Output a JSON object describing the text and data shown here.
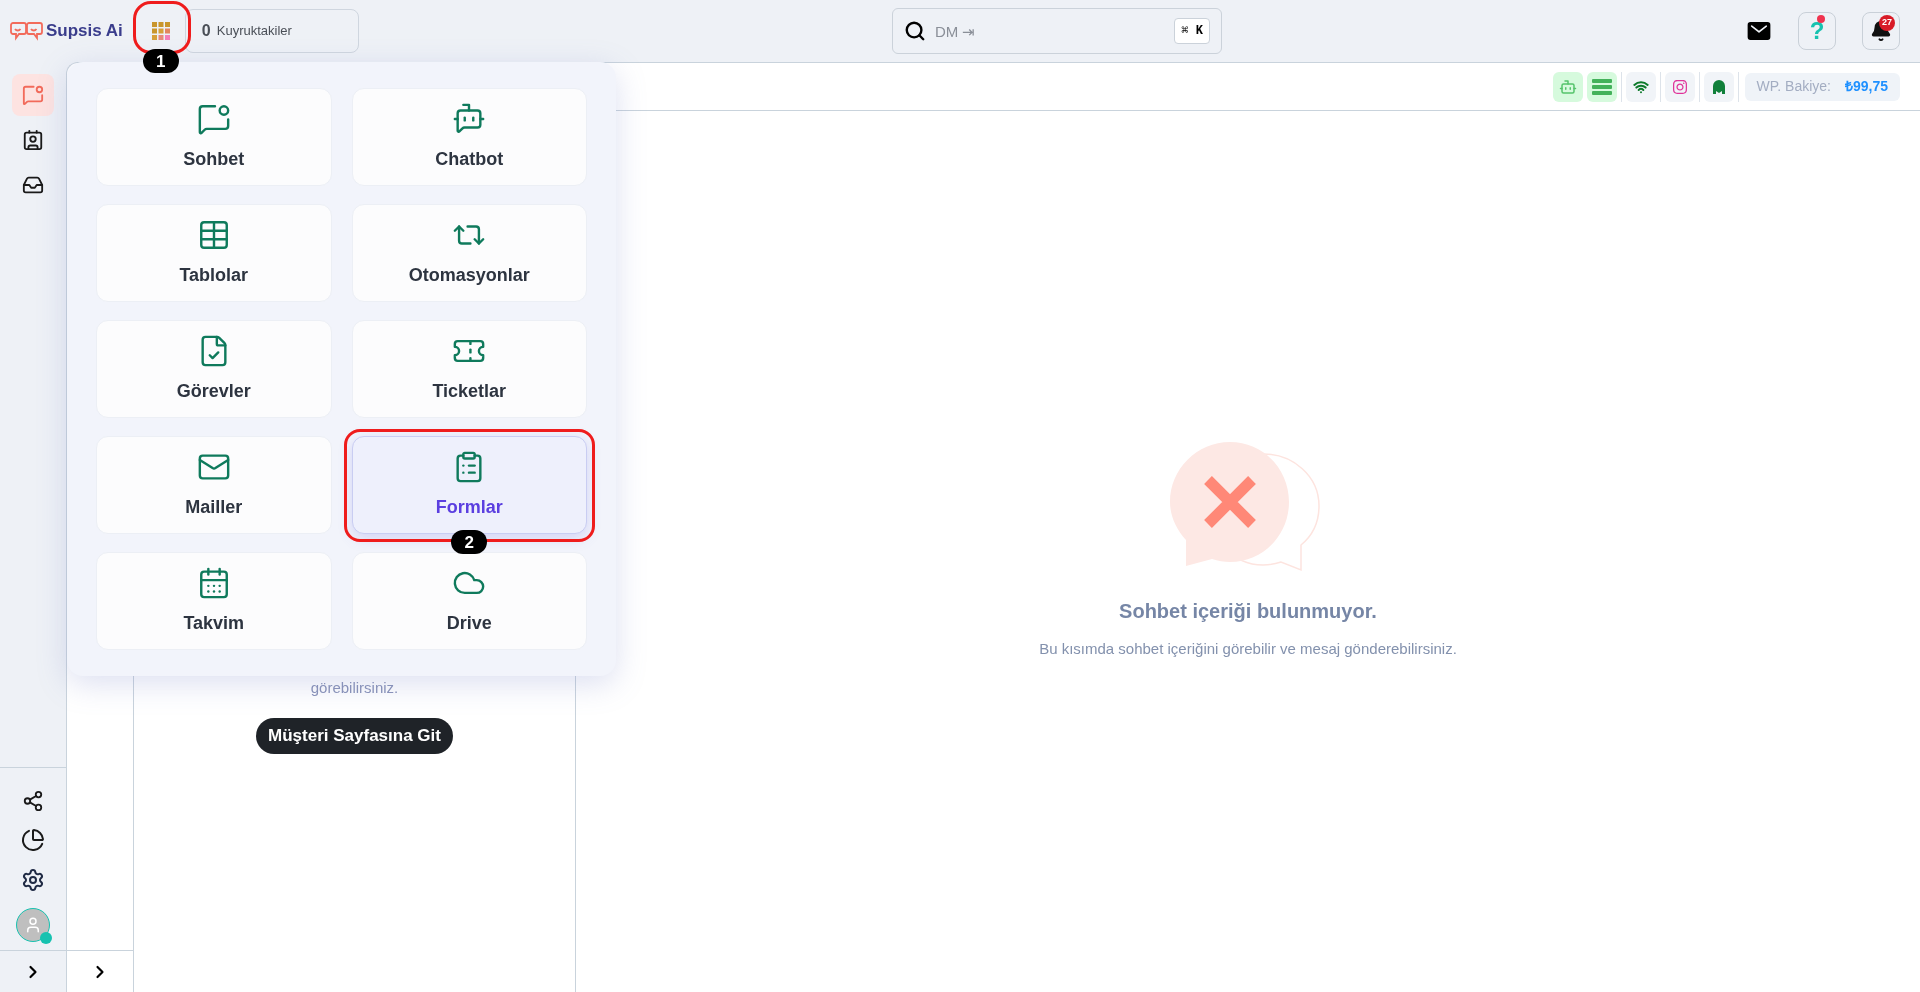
{
  "header": {
    "logo": {
      "text": "Supsis Ai"
    },
    "apps_button": {
      "annotation": "1"
    },
    "queue": {
      "count": "0",
      "label": "Kuyruktakiler"
    },
    "search": {
      "placeholder": "DM ⇥",
      "shortcut": "⌘ **K**"
    },
    "help_button": {
      "label": "?"
    },
    "notifications": {
      "badge": "27"
    }
  },
  "sidebar": {
    "items": [
      {
        "selected": true
      },
      {
        "selected": false
      },
      {
        "selected": false
      }
    ]
  },
  "customer_panel": {
    "text": "görebilirsiniz.",
    "button": "Müşteri Sayfasına Git"
  },
  "channels": {
    "items": [
      {
        "on": true
      },
      {
        "on": true
      },
      {
        "on": false
      },
      {
        "on": false
      },
      {
        "on": false
      }
    ],
    "balance_label": "WP. Bakiye:",
    "balance": "₺99,75"
  },
  "empty_state": {
    "title": "Sohbet içeriği bulunmuyor.",
    "subtitle": "Bu kısımda sohbet içeriğini görebilir ve mesaj gönderebilirsiniz."
  },
  "apps_menu": {
    "items": [
      {
        "label": "Sohbet",
        "selected": false
      },
      {
        "label": "Chatbot",
        "selected": false
      },
      {
        "label": "Tablolar",
        "selected": false
      },
      {
        "label": "Otomasyonlar",
        "selected": false
      },
      {
        "label": "Görevler",
        "selected": false
      },
      {
        "label": "Ticketlar",
        "selected": false
      },
      {
        "label": "Mailler",
        "selected": false
      },
      {
        "label": "Formlar",
        "selected": true,
        "annotation": "2"
      },
      {
        "label": "Takvim",
        "selected": false
      },
      {
        "label": "Drive",
        "selected": false
      }
    ]
  }
}
